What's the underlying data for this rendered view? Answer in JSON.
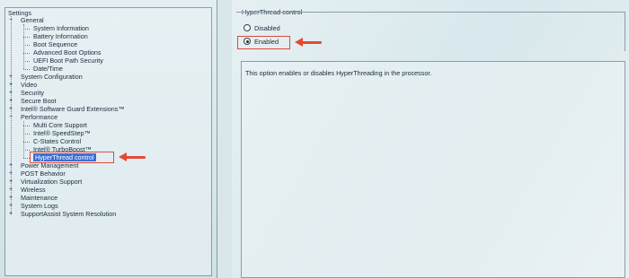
{
  "tree": {
    "root_label": "Settings",
    "items": [
      {
        "label": "General",
        "level": 1,
        "expander": "−"
      },
      {
        "label": "System Information",
        "level": 2
      },
      {
        "label": "Battery Information",
        "level": 2
      },
      {
        "label": "Boot Sequence",
        "level": 2
      },
      {
        "label": "Advanced Boot Options",
        "level": 2
      },
      {
        "label": "UEFI Boot Path Security",
        "level": 2
      },
      {
        "label": "Date/Time",
        "level": 2
      },
      {
        "label": "System Configuration",
        "level": 1,
        "expander": "+"
      },
      {
        "label": "Video",
        "level": 1,
        "expander": "+"
      },
      {
        "label": "Security",
        "level": 1,
        "expander": "+"
      },
      {
        "label": "Secure Boot",
        "level": 1,
        "expander": "+"
      },
      {
        "label": "Intel® Software Guard Extensions™",
        "level": 1,
        "expander": "+"
      },
      {
        "label": "Performance",
        "level": 1,
        "expander": "−"
      },
      {
        "label": "Multi Core Support",
        "level": 2
      },
      {
        "label": "Intel® SpeedStep™",
        "level": 2
      },
      {
        "label": "C-States Control",
        "level": 2
      },
      {
        "label": "Intel® TurboBoost™",
        "level": 2
      },
      {
        "label": "HyperThread control",
        "level": 2,
        "selected": true
      },
      {
        "label": "Power Management",
        "level": 1,
        "expander": "+"
      },
      {
        "label": "POST Behavior",
        "level": 1,
        "expander": "+"
      },
      {
        "label": "Virtualization Support",
        "level": 1,
        "expander": "+"
      },
      {
        "label": "Wireless",
        "level": 1,
        "expander": "+"
      },
      {
        "label": "Maintenance",
        "level": 1,
        "expander": "+"
      },
      {
        "label": "System Logs",
        "level": 1,
        "expander": "+"
      },
      {
        "label": "SupportAssist System Resolution",
        "level": 1,
        "expander": "+"
      }
    ]
  },
  "panel": {
    "group_title": "HyperThread control",
    "options": [
      {
        "label": "Disabled",
        "checked": false
      },
      {
        "label": "Enabled",
        "checked": true
      }
    ],
    "description": "This option enables or disables HyperThreading in the processor."
  },
  "colors": {
    "annotation": "#e34a36",
    "selection": "#3a6fd8"
  }
}
